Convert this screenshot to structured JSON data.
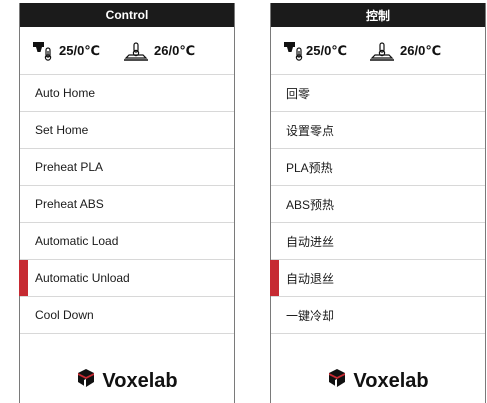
{
  "left": {
    "title": "Control",
    "nozzle_temp": "25/0℃",
    "bed_temp": "26/0℃",
    "menu": [
      "Auto Home",
      "Set Home",
      "Preheat PLA",
      "Preheat ABS",
      "Automatic Load",
      "Automatic Unload",
      "Cool Down"
    ],
    "logo_text": "Voxelab"
  },
  "right": {
    "title": "控制",
    "nozzle_temp": "25/0℃",
    "bed_temp": "26/0℃",
    "menu": [
      "回零",
      "设置零点",
      "PLA预热",
      "ABS预热",
      "自动进丝",
      "自动退丝",
      "一键冷却"
    ],
    "logo_text": "Voxelab"
  },
  "accent_color": "#c62a32",
  "icons": [
    "nozzle-icon",
    "bed-icon",
    "voxelab-logo-icon"
  ]
}
